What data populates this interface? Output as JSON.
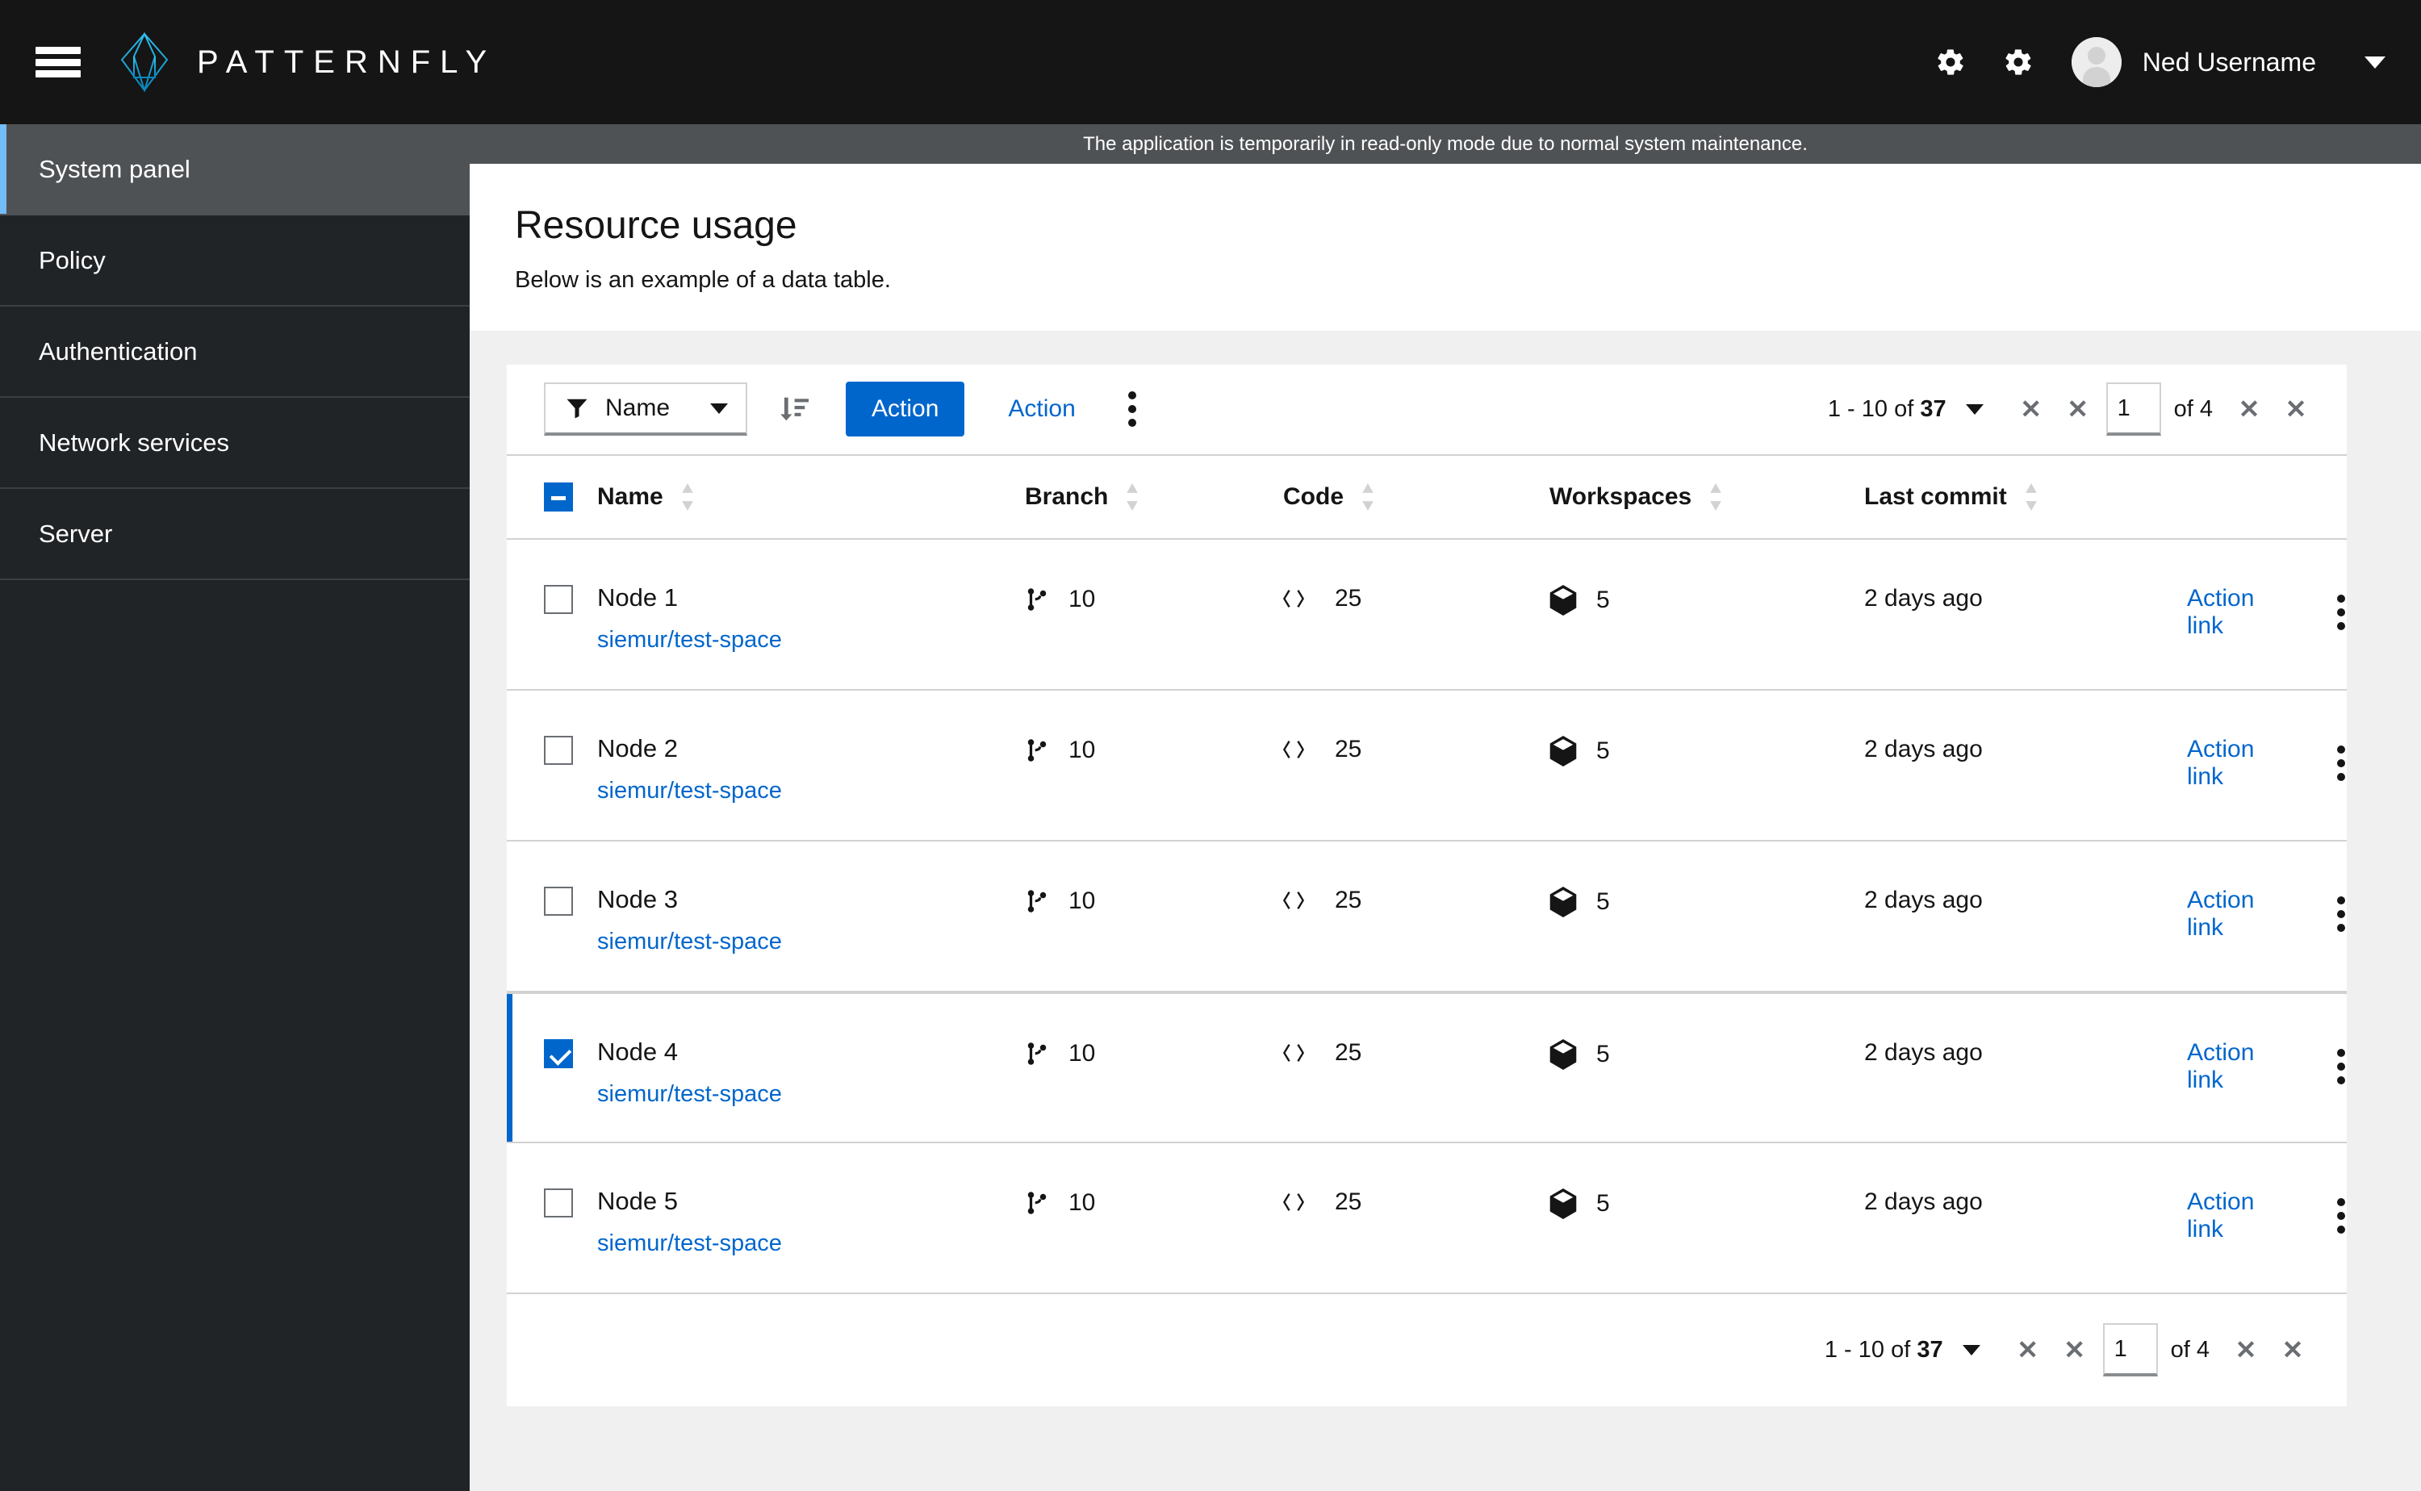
{
  "masthead": {
    "brand_name": "PATTERNFLY",
    "menu_icon": "hamburger-icon",
    "settings_icon_1": "gear-icon",
    "settings_icon_2": "gear-icon",
    "username": "Ned Username",
    "user_caret": "caret-down-icon"
  },
  "sidebar": {
    "items": [
      {
        "label": "System panel",
        "active": true
      },
      {
        "label": "Policy",
        "active": false
      },
      {
        "label": "Authentication",
        "active": false
      },
      {
        "label": "Network services",
        "active": false
      },
      {
        "label": "Server",
        "active": false
      }
    ]
  },
  "banner": {
    "text": "The application is temporarily in read-only mode due to normal system maintenance."
  },
  "page": {
    "title": "Resource usage",
    "subtitle": "Below is an example of a data table."
  },
  "toolbar": {
    "filter_icon": "filter-funnel-icon",
    "filter_label": "Name",
    "filter_caret": "caret-down-icon",
    "sort_icon": "sort-amount-down-icon",
    "primary_action": "Action",
    "secondary_action": "Action",
    "overflow_icon": "kebab-icon"
  },
  "pagination": {
    "summary_range": "1 - 10",
    "summary_of": "of",
    "summary_total": "37",
    "toggle_icon": "caret-down-icon",
    "first_page_icon": "angle-double-left-icon",
    "prev_page_icon": "angle-left-icon",
    "next_page_icon": "angle-right-icon",
    "last_page_icon": "angle-double-right-icon",
    "nav_glyph": "✕",
    "current_page": "1",
    "of_pages": "of 4"
  },
  "table": {
    "select_all_state": "indeterminate",
    "columns": [
      {
        "label": "Name",
        "sort_icon": "sort-icon"
      },
      {
        "label": "Branch",
        "sort_icon": "sort-icon"
      },
      {
        "label": "Code",
        "sort_icon": "sort-icon"
      },
      {
        "label": "Workspaces",
        "sort_icon": "sort-icon"
      },
      {
        "label": "Last commit",
        "sort_icon": "sort-icon"
      }
    ],
    "rows": [
      {
        "selected": false,
        "name": "Node 1",
        "repo": "siemur/test-space",
        "branch": "10",
        "code": "25",
        "workspaces": "5",
        "last_commit": "2 days ago",
        "action_link": "Action link"
      },
      {
        "selected": false,
        "name": "Node 2",
        "repo": "siemur/test-space",
        "branch": "10",
        "code": "25",
        "workspaces": "5",
        "last_commit": "2 days ago",
        "action_link": "Action link"
      },
      {
        "selected": false,
        "name": "Node 3",
        "repo": "siemur/test-space",
        "branch": "10",
        "code": "25",
        "workspaces": "5",
        "last_commit": "2 days ago",
        "action_link": "Action link"
      },
      {
        "selected": true,
        "name": "Node 4",
        "repo": "siemur/test-space",
        "branch": "10",
        "code": "25",
        "workspaces": "5",
        "last_commit": "2 days ago",
        "action_link": "Action link"
      },
      {
        "selected": false,
        "name": "Node 5",
        "repo": "siemur/test-space",
        "branch": "10",
        "code": "25",
        "workspaces": "5",
        "last_commit": "2 days ago",
        "action_link": "Action link"
      }
    ],
    "row_icons": {
      "branch": "code-branch-icon",
      "code": "code-icon",
      "workspaces": "cube-icon",
      "overflow": "kebab-icon"
    }
  },
  "colors": {
    "masthead_bg": "#151515",
    "sidebar_bg": "#212427",
    "sidebar_active_bg": "#4f5255",
    "sidebar_active_accent": "#73bcf7",
    "banner_bg": "#4f5255",
    "brand_accent": "#20b9e8",
    "primary_blue": "#0066cc",
    "link_blue": "#06c",
    "content_bg": "#f0f0f0",
    "border": "#d2d2d2"
  }
}
